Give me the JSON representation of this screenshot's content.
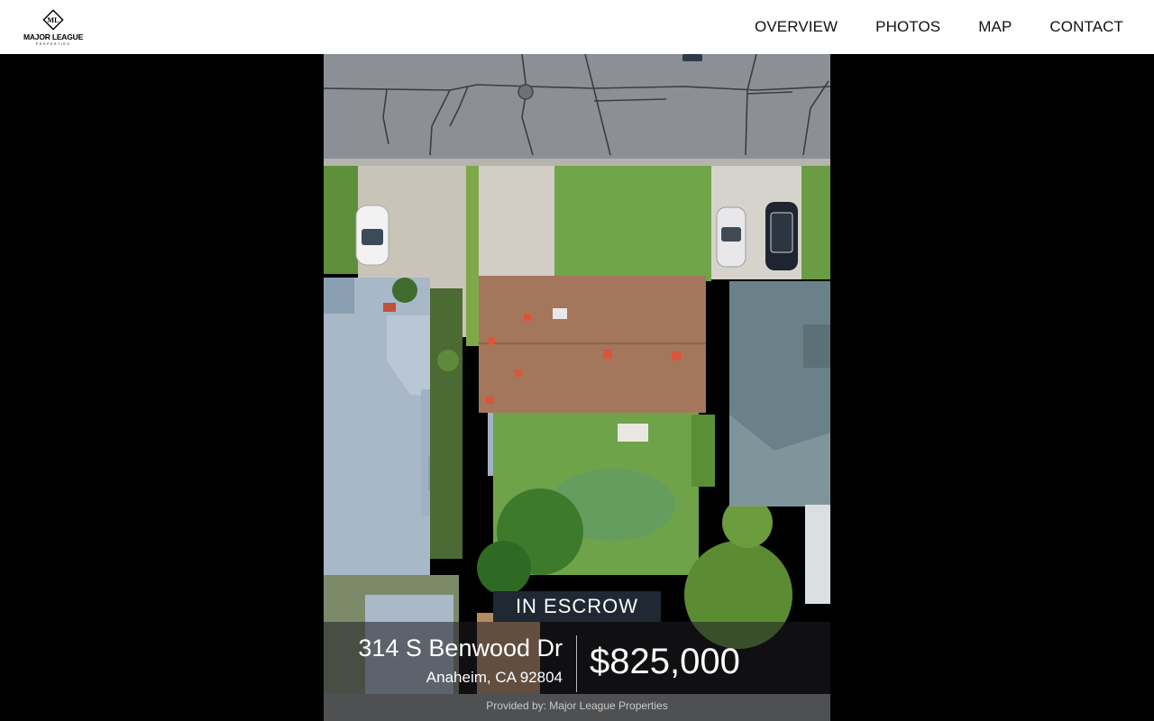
{
  "brand": {
    "name": "MAJOR LEAGUE",
    "sub": "PROPERTIES",
    "mark_text": "ML"
  },
  "nav": {
    "items": [
      {
        "label": "OVERVIEW"
      },
      {
        "label": "PHOTOS"
      },
      {
        "label": "MAP"
      },
      {
        "label": "CONTACT"
      }
    ]
  },
  "listing": {
    "status": "IN ESCROW",
    "street": "314 S Benwood Dr",
    "city_line": "Anaheim, CA 92804",
    "price": "$825,000",
    "provided_by": "Provided by: Major League Properties"
  },
  "colors": {
    "header_bg": "#ffffff",
    "stage_bg": "#000000",
    "badge_bg": "#1f2833",
    "text_on_dark": "#ffffff"
  },
  "icons": {
    "logo": "diamond-monogram-icon"
  }
}
